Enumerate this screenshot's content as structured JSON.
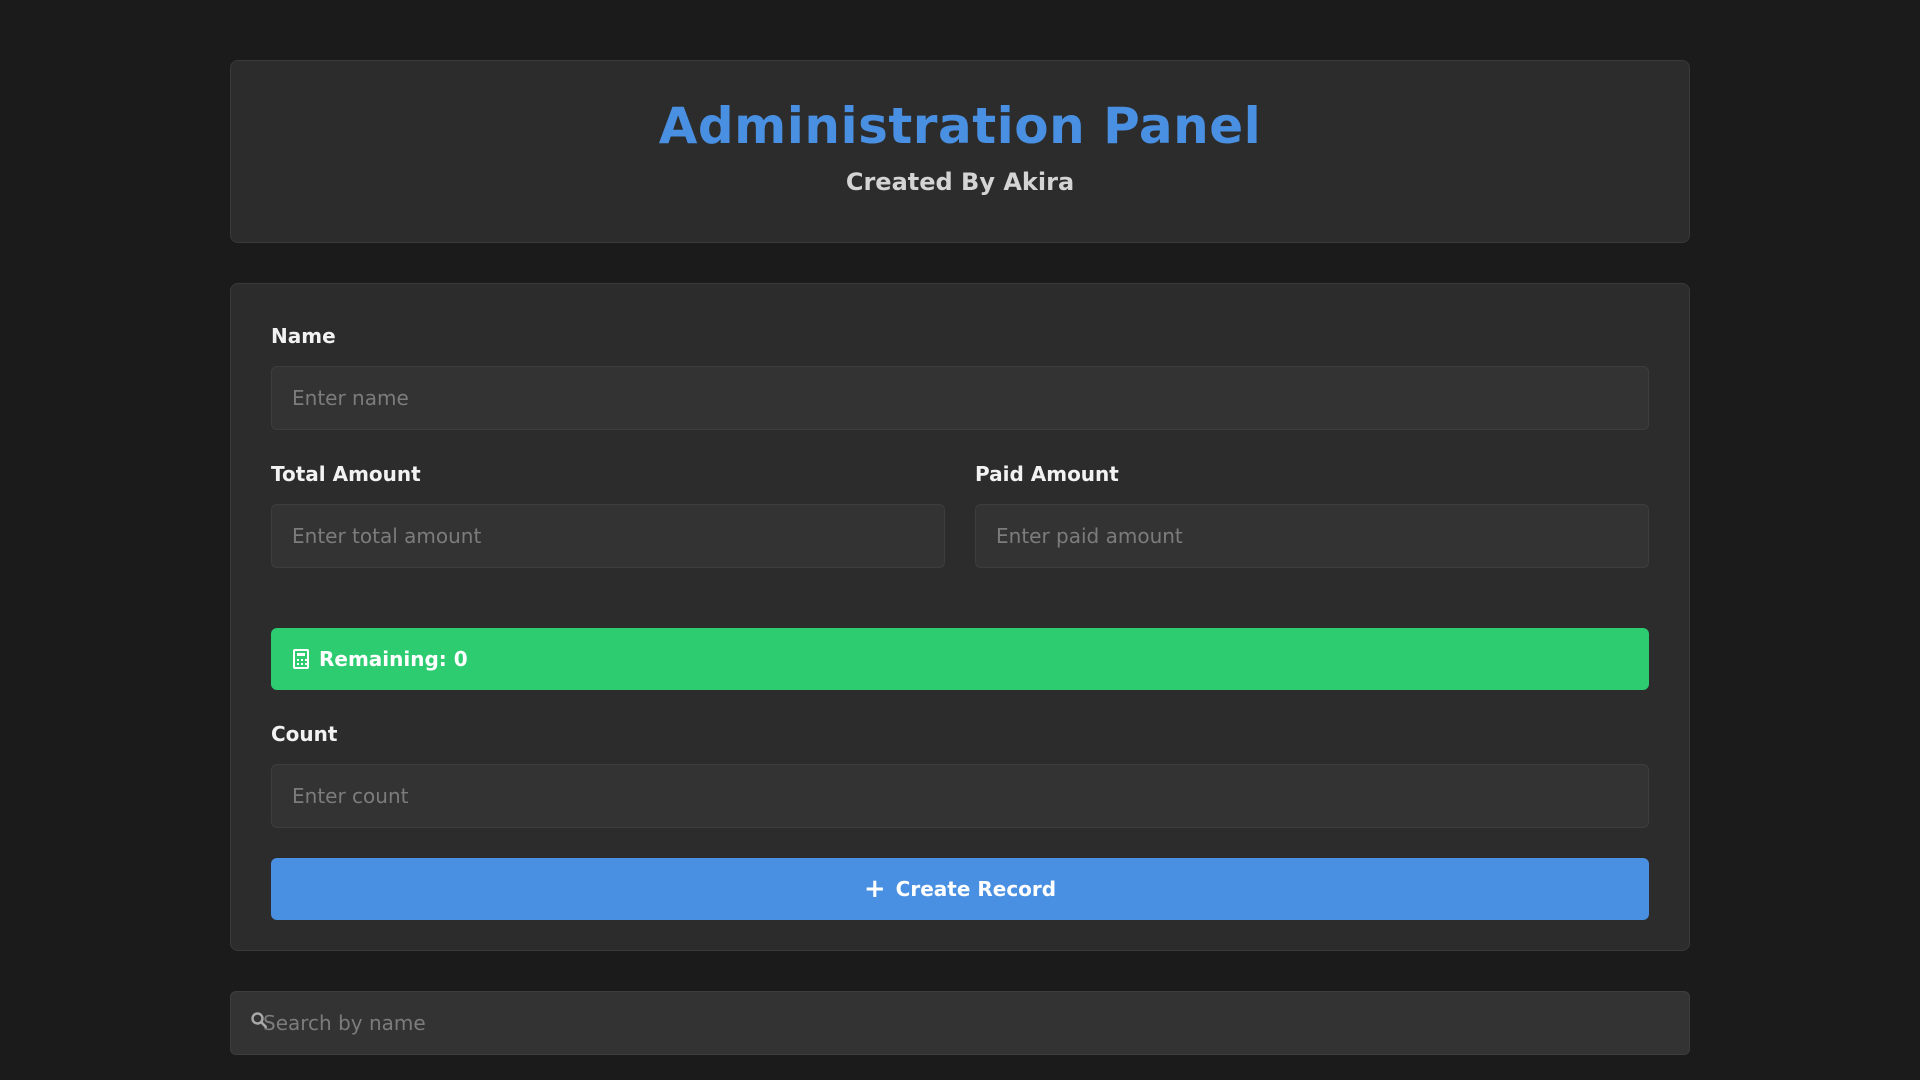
{
  "header": {
    "title": "Administration Panel",
    "subtitle": "Created By Akira"
  },
  "form": {
    "name": {
      "label": "Name",
      "placeholder": "Enter name",
      "value": ""
    },
    "total_amount": {
      "label": "Total Amount",
      "placeholder": "Enter total amount",
      "value": ""
    },
    "paid_amount": {
      "label": "Paid Amount",
      "placeholder": "Enter paid amount",
      "value": ""
    },
    "remaining": {
      "text": "Remaining: 0",
      "icon": "calculator-icon"
    },
    "count": {
      "label": "Count",
      "placeholder": "Enter count",
      "value": ""
    },
    "submit": {
      "label": "Create Record",
      "icon": "plus-icon"
    }
  },
  "search": {
    "placeholder": "Search by name",
    "icon": "search-icon"
  },
  "colors": {
    "background": "#1b1b1b",
    "card": "#2c2c2c",
    "accent": "#4a90e2",
    "success": "#2ecc71"
  }
}
